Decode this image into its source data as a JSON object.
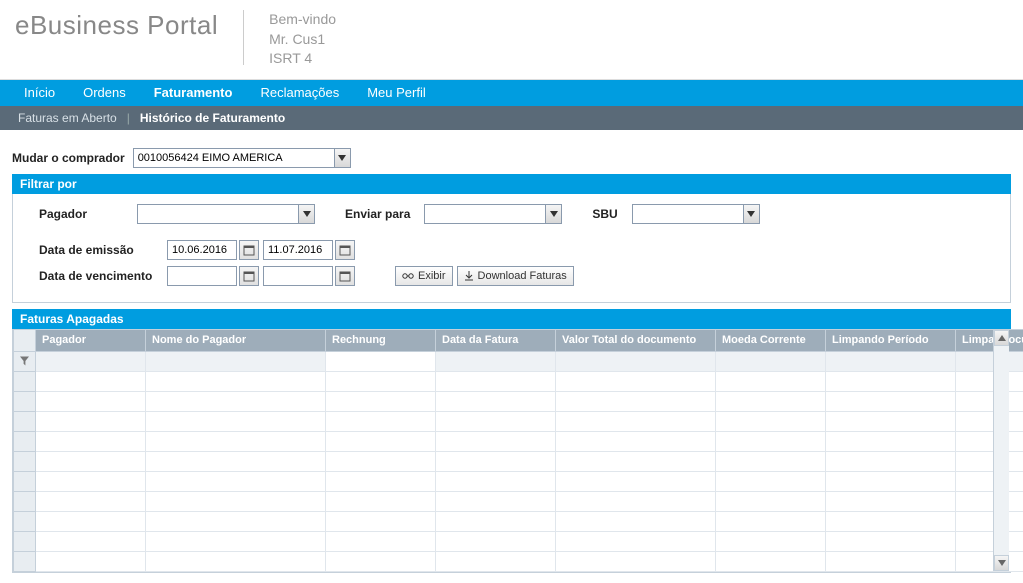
{
  "header": {
    "logo": "eBusiness Portal",
    "welcome_line1": "Bem-vindo",
    "welcome_line2": "Mr. Cus1",
    "welcome_line3": "ISRT 4"
  },
  "nav_primary": {
    "items": [
      {
        "label": "Início",
        "active": false
      },
      {
        "label": "Ordens",
        "active": false
      },
      {
        "label": "Faturamento",
        "active": true
      },
      {
        "label": "Reclamações",
        "active": false
      },
      {
        "label": "Meu Perfil",
        "active": false
      }
    ]
  },
  "nav_secondary": {
    "items": [
      {
        "label": "Faturas em Aberto",
        "active": false
      },
      {
        "label": "Histórico de Faturamento",
        "active": true
      }
    ]
  },
  "buyer": {
    "label": "Mudar o comprador",
    "value": "0010056424 EIMO AMERICA"
  },
  "filter": {
    "title": "Filtrar por",
    "pagador_label": "Pagador",
    "pagador_value": "",
    "enviar_label": "Enviar para",
    "enviar_value": "",
    "sbu_label": "SBU",
    "sbu_value": "",
    "emissao_label": "Data de emissão",
    "emissao_from": "10.06.2016",
    "emissao_to": "11.07.2016",
    "venc_label": "Data de vencimento",
    "venc_from": "",
    "venc_to": "",
    "exibir_btn": "Exibir",
    "download_btn": "Download Faturas"
  },
  "table": {
    "title": "Faturas Apagadas",
    "columns": [
      "Pagador",
      "Nome do Pagador",
      "Rechnung",
      "Data da Fatura",
      "Valor Total do documento",
      "Moeda Corrente",
      "Limpando Período",
      "Limpar documento"
    ],
    "rows": 10
  }
}
